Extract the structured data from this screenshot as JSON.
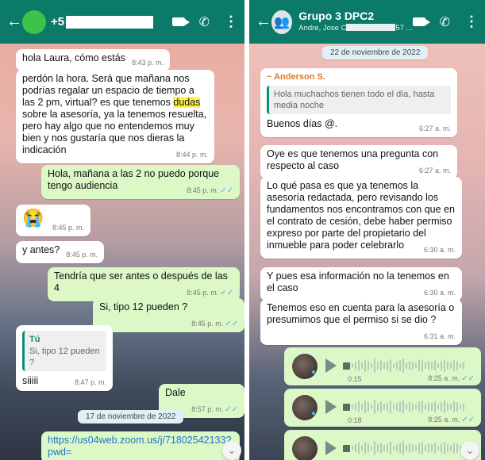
{
  "left": {
    "header": {
      "contact_prefix": "+5"
    },
    "messages": [
      {
        "text": "hola Laura, cómo estás",
        "time": "8:43 p. m."
      },
      {
        "text_before": "perdón la hora. Será que mañana nos podrías regalar un espacio de tiempo a las 2 pm, virtual? es que tenemos ",
        "highlight": "dudas",
        "text_after": " sobre la asesoría, ya la tenemos resuelta, pero hay algo que no entendemos muy bien y nos gustaría que nos dieras la indicación",
        "time": "8:44 p. m."
      },
      {
        "text": "Hola, mañana a las 2 no puedo porque tengo audiencia",
        "time": "8:45 p. m."
      },
      {
        "emoji": "😭",
        "time": "8:45 p. m."
      },
      {
        "text": "y antes?",
        "time": "8:45 p. m."
      },
      {
        "text": "Tendría que ser antes o después de las 4",
        "time": "8:45 p. m."
      },
      {
        "text": "Si, tipo 12 pueden ?",
        "time": "8:45 p. m."
      },
      {
        "quote_name": "Tú",
        "quote_text": "Si, tipo 12 pueden ?",
        "text": "siiiii",
        "time": "8:47 p. m."
      },
      {
        "text": "Dale",
        "time": "8:57 p. m."
      },
      {
        "text": "https://us04web.zoom.us/j/71802542133?pwd="
      }
    ],
    "date_pill": "17 de noviembre de 2022"
  },
  "right": {
    "header": {
      "title": "Grupo 3 DPC2",
      "subtitle_prefix": "Andre, Jose C",
      "subtitle_suffix": "57 ..."
    },
    "date_pill": "22 de noviembre de 2022",
    "messages": [
      {
        "sender": "~ Anderson S.",
        "quote_text": "Hola muchachos tienen todo el día, hasta media noche",
        "text": "Buenos días @.",
        "time": "6:27 a. m."
      },
      {
        "text": "Oye es que tenemos una pregunta con respecto al caso",
        "time": "6:27 a. m."
      },
      {
        "text": "Lo qué pasa es que ya tenemos la asesoría redactada, pero revisando los fundamentos nos encontramos con que en el contrato de cesión, debe haber permiso expreso por parte del propietario del inmueble para poder celebrarlo",
        "time": "6:30 a. m."
      },
      {
        "text": "Y pues esa información no la tenemos en el caso",
        "time": "6:30 a. m."
      },
      {
        "text": "Tenemos eso en cuenta para la asesoría o presumimos que el permiso si se dio ?",
        "time": "6:31 a. m."
      }
    ],
    "audios": [
      {
        "duration": "0:15",
        "time": "8:25 a. m."
      },
      {
        "duration": "0:18",
        "time": "8:25 a. m."
      },
      {
        "duration": "",
        "time": ""
      }
    ]
  },
  "colors": {
    "header": "#0b7a68",
    "outgoing": "#dcf8c6",
    "incoming": "#ffffff",
    "ticks": "#4fb3e8"
  }
}
